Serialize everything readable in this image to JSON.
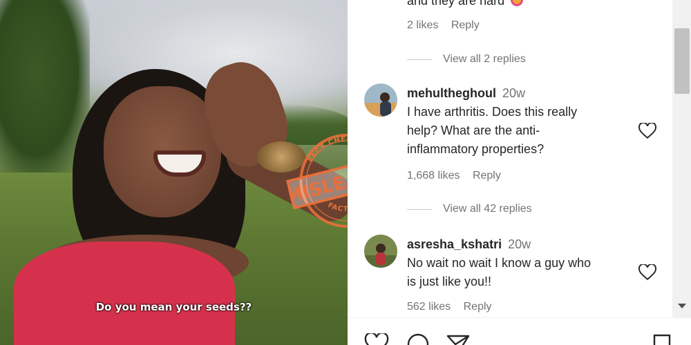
{
  "video": {
    "caption": "Do you mean your seeds??"
  },
  "stamp": {
    "label": "MISLEADING",
    "top_text": "FACT CHECKED",
    "bottom_text": "FACT CHECK",
    "color": "#e8703a"
  },
  "comments": {
    "partial": {
      "text": "and they are hard",
      "likes": "2 likes",
      "reply": "Reply",
      "view_replies": "View all 2 replies"
    },
    "items": [
      {
        "username": "mehultheghoul",
        "time": "20w",
        "text_lines": [
          "I have arthritis. Does this really",
          "help? What are the anti-",
          "inflammatory properties?"
        ],
        "likes": "1,668 likes",
        "reply": "Reply",
        "view_replies": "View all 42 replies"
      },
      {
        "username": "asresha_kshatri",
        "time": "20w",
        "text_lines": [
          "No wait no wait I know a guy who",
          "is just like you!!"
        ],
        "likes": "562 likes",
        "reply": "Reply"
      }
    ]
  },
  "icons": {
    "like": "heart-icon",
    "comment": "comment-icon",
    "share": "send-icon",
    "save": "bookmark-icon"
  }
}
